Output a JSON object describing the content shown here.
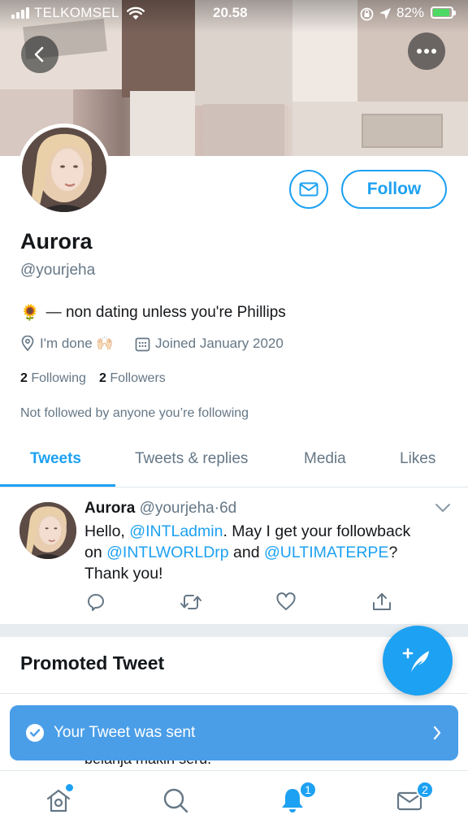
{
  "status_bar": {
    "carrier": "TELKOMSEL",
    "time": "20.58",
    "battery_percent": "82%"
  },
  "profile": {
    "name": "Aurora",
    "handle": "@yourjeha",
    "bio_emoji": "🌻",
    "bio": "— non dating unless you're Phillips",
    "location": "I'm done 🙌🏻",
    "joined": "Joined January 2020",
    "following_count": "2",
    "following_label": "Following",
    "followers_count": "2",
    "followers_label": "Followers",
    "not_followed_note": "Not followed by anyone you’re following",
    "follow_label": "Follow"
  },
  "tabs": [
    {
      "label": "Tweets",
      "active": true
    },
    {
      "label": "Tweets & replies",
      "active": false
    },
    {
      "label": "Media",
      "active": false
    },
    {
      "label": "Likes",
      "active": false
    }
  ],
  "tweet": {
    "author": "Aurora",
    "handle": "@yourjeha",
    "separator": "·",
    "age": "6d",
    "text_1": "Hello, ",
    "mention_1": "@INTLadmin",
    "text_2": ". May I get your followback on ",
    "mention_2": "@INTLWORLDrp",
    "text_3": " and ",
    "mention_3": "@ULTIMATERPE",
    "text_4": "? Thank you!"
  },
  "promoted": {
    "heading": "Promoted Tweet",
    "peek_text": "belanja makin seru."
  },
  "toast": {
    "message": "Your Tweet was sent"
  },
  "tabbar": {
    "notifications_badge": "1",
    "messages_badge": "2"
  },
  "colors": {
    "accent": "#1da1f2",
    "toast": "#4a9ee8",
    "muted": "#657786"
  }
}
